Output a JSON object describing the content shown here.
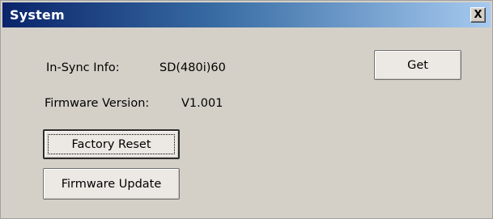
{
  "window": {
    "title": "System",
    "close_label": "X"
  },
  "info": {
    "insync_label": "In-Sync Info:",
    "insync_value": "SD(480i)60",
    "firmware_label": "Firmware Version:",
    "firmware_value": "V1.001"
  },
  "buttons": {
    "get_label": "Get",
    "factory_reset_label": "Factory Reset",
    "firmware_update_label": "Firmware Update"
  }
}
